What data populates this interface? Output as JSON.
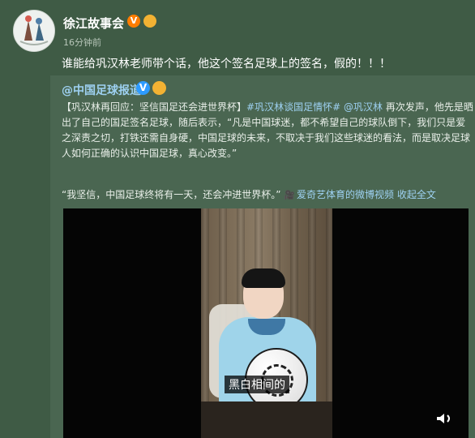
{
  "post": {
    "author": {
      "name": "徐江故事会"
    },
    "timestamp": "16分钟前",
    "text": "谁能给巩汉林老师带个话，他这个签名足球上的签名，假的！！！"
  },
  "repost": {
    "author": "@中国足球报道",
    "body": {
      "intro": "【巩汉林再回应：坚信国足还会进世界杯】",
      "topic": "#巩汉林谈国足情怀#",
      "mention": "@巩汉林",
      "text": "再次发声，他先是晒出了自己的国足签名足球，随后表示，“凡是中国球迷，都不希望自己的球队倒下，我们只是爱之深责之切，打铁还需自身硬，中国足球的未来，不取决于我们这些球迷的看法，而是取决足球人如何正确的认识中国足球，真心改变。”"
    },
    "quote": {
      "text": "“我坚信，中国足球终将有一天，还会冲进世界杯。”",
      "video_link": "爱奇艺体育的微博视频",
      "collapse": "收起全文"
    },
    "video": {
      "subtitle": "黑白相间的"
    }
  },
  "colors": {
    "page_background": "#3f5b45",
    "repost_background": "#4a6651",
    "link": "#9ed1f2"
  },
  "icons": {
    "author_badge": "v-orange-badge",
    "emoji_badge": "emoji-badge",
    "video": "video-camera-icon",
    "mute": "speaker-mute-icon"
  }
}
